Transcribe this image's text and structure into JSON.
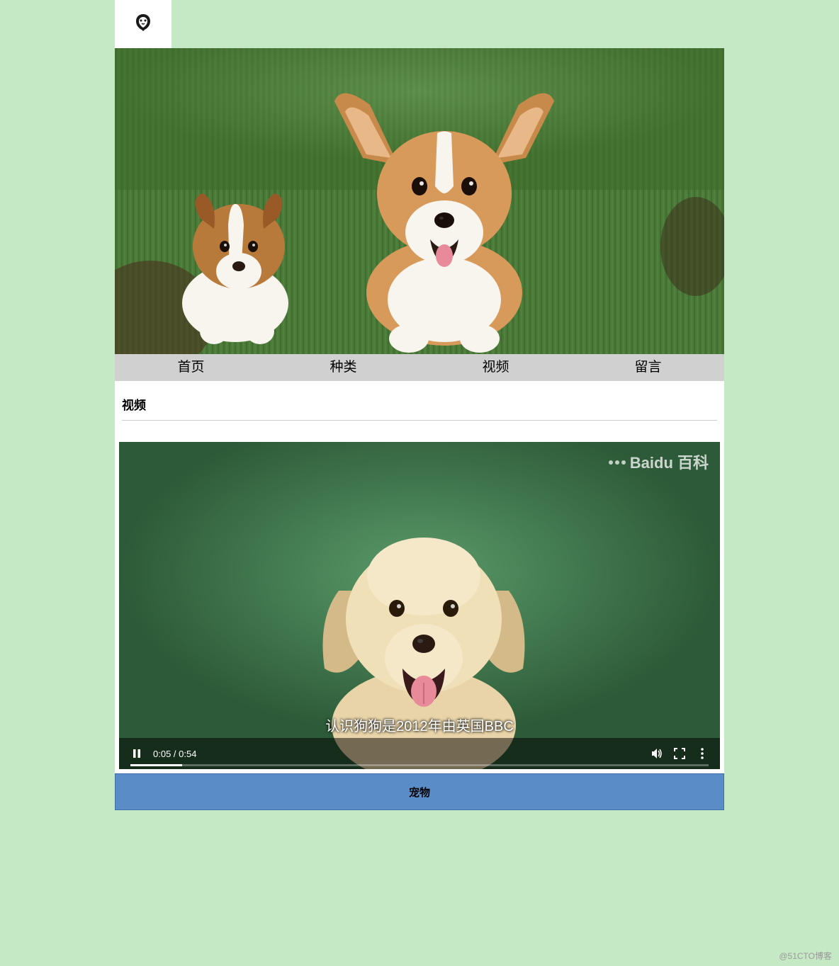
{
  "nav": {
    "items": [
      {
        "label": "首页"
      },
      {
        "label": "种类"
      },
      {
        "label": "视频"
      },
      {
        "label": "留言"
      }
    ]
  },
  "section": {
    "title": "视频"
  },
  "video": {
    "watermark": "Baidu 百科",
    "subtitle": "认识狗狗是2012年由英国BBC",
    "current_time": "0:05",
    "duration": "0:54",
    "time_display": "0:05 / 0:54"
  },
  "footer": {
    "title": "宠物"
  },
  "attribution": "@51CTO博客"
}
